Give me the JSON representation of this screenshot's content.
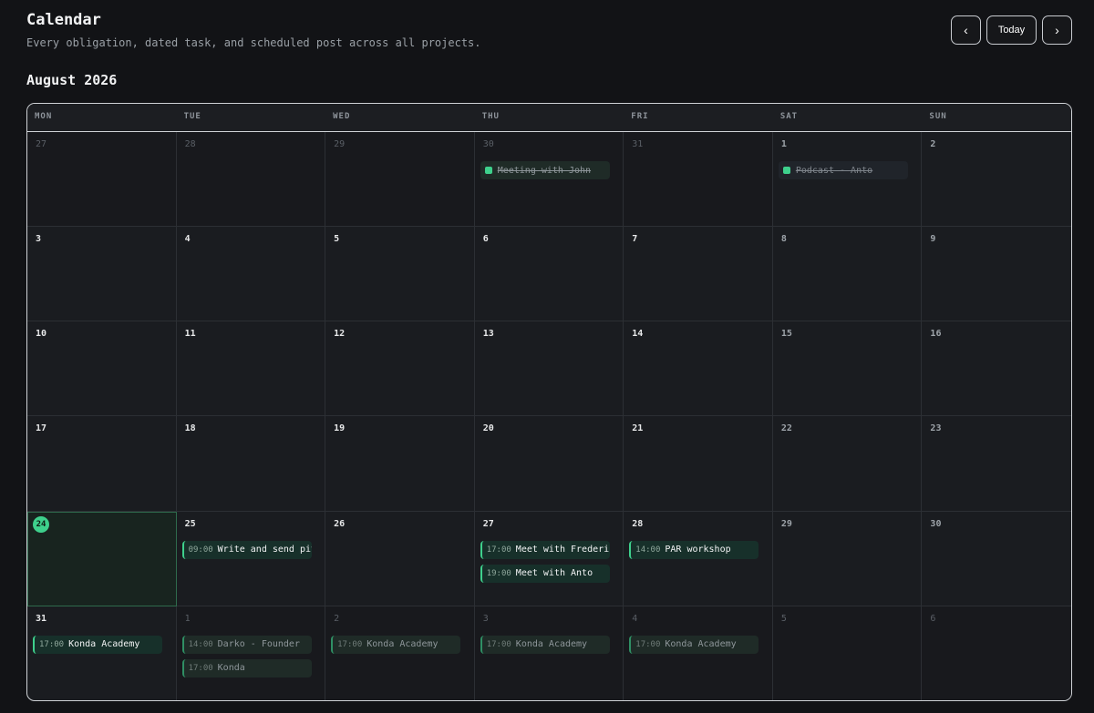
{
  "header": {
    "title": "Calendar",
    "subtitle": "Every obligation, dated task, and scheduled post across all projects."
  },
  "nav": {
    "prev_icon": "chevron-left-icon",
    "today_label": "Today",
    "next_icon": "chevron-right-icon"
  },
  "month_label": "August 2026",
  "weekdays": [
    "MON",
    "TUE",
    "WED",
    "THU",
    "FRI",
    "SAT",
    "SUN"
  ],
  "colors": {
    "accent": "#3ed08c",
    "background": "#121316",
    "event_bg": "#17302a"
  },
  "weeks": [
    [
      {
        "day": "27",
        "out": true
      },
      {
        "day": "28",
        "out": true
      },
      {
        "day": "29",
        "out": true
      },
      {
        "day": "30",
        "out": true,
        "events": [
          {
            "title": "Meeting with John",
            "done": true
          }
        ]
      },
      {
        "day": "31",
        "out": true
      },
      {
        "day": "1",
        "weekend": true,
        "events": [
          {
            "title": "Podcast - Anto",
            "done": true
          }
        ]
      },
      {
        "day": "2",
        "weekend": true
      }
    ],
    [
      {
        "day": "3"
      },
      {
        "day": "4"
      },
      {
        "day": "5"
      },
      {
        "day": "6"
      },
      {
        "day": "7"
      },
      {
        "day": "8",
        "weekend": true
      },
      {
        "day": "9",
        "weekend": true
      }
    ],
    [
      {
        "day": "10"
      },
      {
        "day": "11"
      },
      {
        "day": "12"
      },
      {
        "day": "13"
      },
      {
        "day": "14"
      },
      {
        "day": "15",
        "weekend": true
      },
      {
        "day": "16",
        "weekend": true
      }
    ],
    [
      {
        "day": "17"
      },
      {
        "day": "18"
      },
      {
        "day": "19"
      },
      {
        "day": "20"
      },
      {
        "day": "21"
      },
      {
        "day": "22",
        "weekend": true
      },
      {
        "day": "23",
        "weekend": true
      }
    ],
    [
      {
        "day": "24",
        "today": true
      },
      {
        "day": "25",
        "events": [
          {
            "time": "09:00",
            "title": "Write and send pitch"
          }
        ]
      },
      {
        "day": "26"
      },
      {
        "day": "27",
        "events": [
          {
            "time": "17:00",
            "title": "Meet with Frederick"
          },
          {
            "time": "19:00",
            "title": "Meet with Anto"
          }
        ]
      },
      {
        "day": "28",
        "events": [
          {
            "time": "14:00",
            "title": "PAR workshop"
          }
        ]
      },
      {
        "day": "29",
        "weekend": true
      },
      {
        "day": "30",
        "weekend": true
      }
    ],
    [
      {
        "day": "31",
        "events": [
          {
            "time": "17:00",
            "title": "Konda Academy"
          }
        ]
      },
      {
        "day": "1",
        "out": true,
        "events": [
          {
            "time": "14:00",
            "title": "Darko - Founder"
          },
          {
            "time": "17:00",
            "title": "Konda"
          }
        ]
      },
      {
        "day": "2",
        "out": true,
        "events": [
          {
            "time": "17:00",
            "title": "Konda Academy"
          }
        ]
      },
      {
        "day": "3",
        "out": true,
        "events": [
          {
            "time": "17:00",
            "title": "Konda Academy"
          }
        ]
      },
      {
        "day": "4",
        "out": true,
        "events": [
          {
            "time": "17:00",
            "title": "Konda Academy"
          }
        ]
      },
      {
        "day": "5",
        "out": true
      },
      {
        "day": "6",
        "out": true
      }
    ]
  ]
}
